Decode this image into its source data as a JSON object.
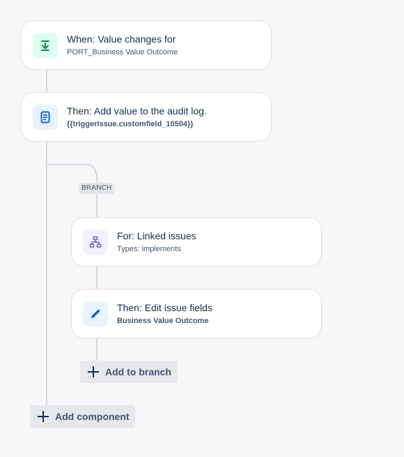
{
  "rule_steps": [
    {
      "title": "When: Value changes for",
      "subtitle": "PORT_Business Value Outcome",
      "icon": "download-arrow-icon"
    },
    {
      "title": "Then: Add value to the audit log.",
      "subtitle": "{{triggerIssue.customfield_10504}}",
      "icon": "document-icon"
    }
  ],
  "branch": {
    "tag": "BRANCH",
    "steps": [
      {
        "title": "For: Linked issues",
        "subtitle": "Types: implements",
        "icon": "hierarchy-icon"
      },
      {
        "title": "Then: Edit issue fields",
        "subtitle": "Business Value Outcome",
        "icon": "pencil-icon"
      }
    ],
    "add_label": "Add to branch"
  },
  "add_component_label": "Add component",
  "colors": {
    "background": "#f6f7f9",
    "trigger_accent": "#1f845a",
    "action_accent": "#0c66e4",
    "branch_accent": "#6e5dc6"
  }
}
